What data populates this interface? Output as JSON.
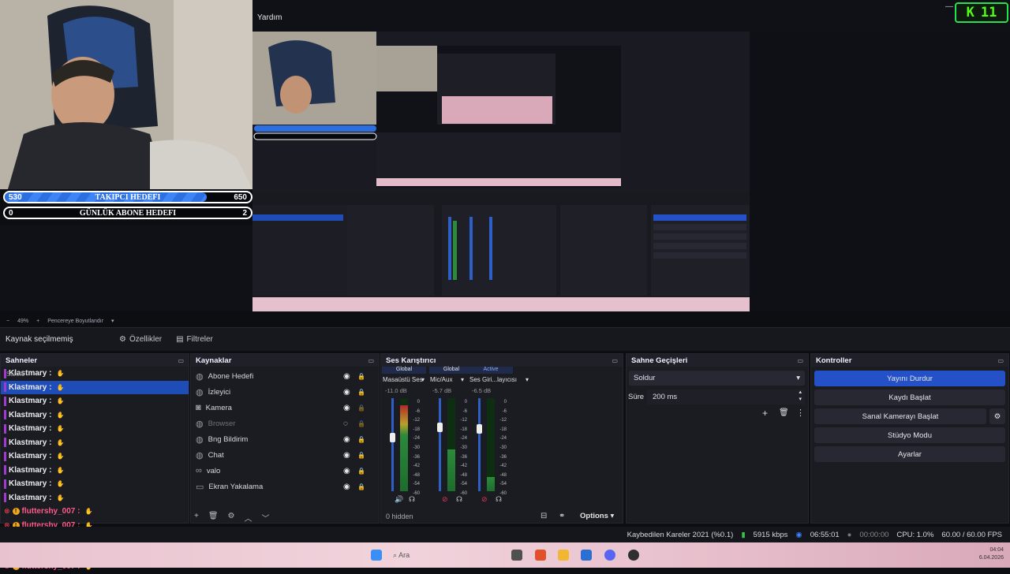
{
  "menu": {
    "help": "Yardım"
  },
  "kick_badge": {
    "count": "11"
  },
  "goals": [
    {
      "title": "TAKIPCI HEDEFI",
      "current": "530",
      "target": "650",
      "progress": 0.815
    },
    {
      "title": "GÜNLÜK ABONE HEDEFI",
      "current": "0",
      "target": "2",
      "progress": 0
    }
  ],
  "zoom": {
    "level": "49%",
    "mode": "Pencereye Boyutlandır"
  },
  "propbar": {
    "no_source": "Kaynak seçilmemiş",
    "properties": "Özellikler",
    "filters": "Filtreler"
  },
  "scenes": {
    "title": "Sahneler",
    "header_item": "Sahne",
    "items": [
      {
        "label": "Klastmary :",
        "selected": false
      },
      {
        "label": "Klastmary :",
        "selected": true
      },
      {
        "label": "Klastmary :",
        "selected": false
      },
      {
        "label": "Klastmary :",
        "selected": false
      },
      {
        "label": "Klastmary :",
        "selected": false
      },
      {
        "label": "Klastmary :",
        "selected": false
      },
      {
        "label": "Klastmary :",
        "selected": false
      },
      {
        "label": "Klastmary :",
        "selected": false
      },
      {
        "label": "Klastmary :",
        "selected": false
      },
      {
        "label": "Klastmary :",
        "selected": false
      },
      {
        "label": "fluttershy_007 :",
        "selected": false
      },
      {
        "label": "fluttershy_007 :",
        "selected": false
      },
      {
        "label": "fluttershy_007 :",
        "selected": false
      },
      {
        "label": "fluttershy_007 :",
        "selected": false
      },
      {
        "label": "fluttershy_007 :",
        "selected": false
      }
    ]
  },
  "sources": {
    "title": "Kaynaklar",
    "items": [
      {
        "label": "Abone Hedefi",
        "icon": "globe-icon",
        "locked": true
      },
      {
        "label": "İzleyici",
        "icon": "globe-icon",
        "locked": true
      },
      {
        "label": "Kamera",
        "icon": "camera-icon",
        "locked": false
      },
      {
        "label": "Browser",
        "icon": "globe-icon",
        "locked": false,
        "hidden": true
      },
      {
        "label": "Bng Bildirim",
        "icon": "globe-icon",
        "locked": true
      },
      {
        "label": "Chat",
        "icon": "globe-icon",
        "locked": true
      },
      {
        "label": "valo",
        "icon": "link-icon",
        "locked": true
      },
      {
        "label": "Ekran Yakalama",
        "icon": "monitor-icon",
        "locked": true
      }
    ]
  },
  "mixer": {
    "title": "Ses Karıştırıcı",
    "channels": [
      {
        "tag": "Global",
        "name": "Masaüstü Ses",
        "db": "-11.0 dB",
        "level": 0.92,
        "fader": 0.63
      },
      {
        "tag": "Global",
        "name": "Mic/Aux",
        "db": "-5.7 dB",
        "level": 0.45,
        "fader": 0.74
      },
      {
        "tag": "Active",
        "name": "Ses Giri...layıcısı",
        "db": "-6.5 dB",
        "level": 0.15,
        "fader": 0.72
      }
    ],
    "scale": [
      "0",
      "-6",
      "-12",
      "-18",
      "-24",
      "-30",
      "-36",
      "-42",
      "-48",
      "-54",
      "-60"
    ],
    "hidden": "0 hidden",
    "options": "Options"
  },
  "transitions": {
    "title": "Sahne Geçişleri",
    "type": "Soldur",
    "duration_label": "Süre",
    "duration": "200 ms"
  },
  "controls": {
    "title": "Kontroller",
    "stop_stream": "Yayını Durdur",
    "start_record": "Kaydı Başlat",
    "virtual_cam": "Sanal Kamerayı Başlat",
    "studio_mode": "Stüdyo Modu",
    "settings": "Ayarlar"
  },
  "status": {
    "dropped": "Kaybedilen Kareler 2021 (%0.1)",
    "bitrate": "5915 kbps",
    "stream_time": "06:55:01",
    "rec_time": "00:00:00",
    "cpu": "CPU: 1.0%",
    "fps": "60.00 / 60.00 FPS"
  },
  "taskbar": {
    "search": "Ara",
    "time": "04:04",
    "date": "6.04.2026"
  },
  "colors": {
    "accent": "#2451c7",
    "kick": "#53fc18",
    "scene_pink": "#ff5a8a"
  }
}
